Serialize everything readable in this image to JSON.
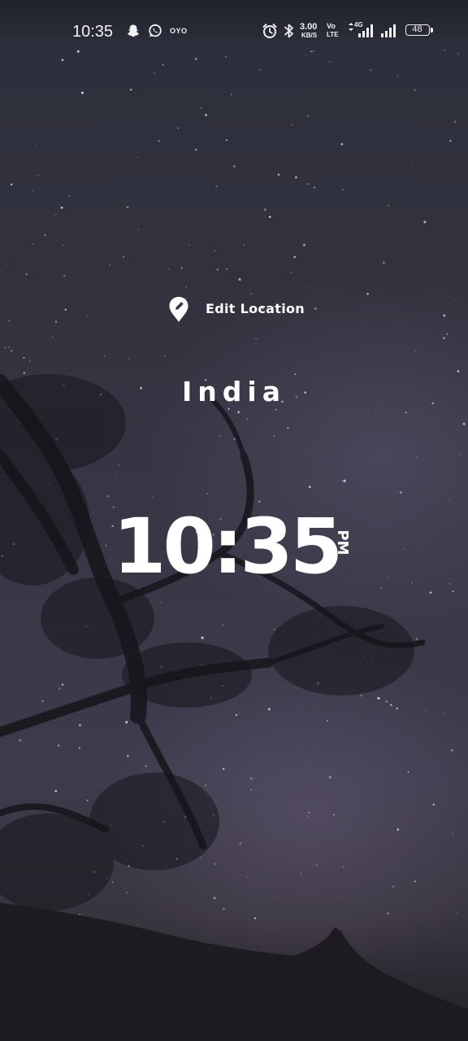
{
  "status_bar": {
    "time": "10:35",
    "notification_icons": [
      "snapchat-icon",
      "whatsapp-icon",
      "oyo-icon"
    ],
    "oyo_label": "OYO",
    "network_speed_value": "3.00",
    "network_speed_unit": "KB/S",
    "volte_top": "Vo",
    "volte_bottom": "LTE",
    "network_type": "4G",
    "system_icons": [
      "alarm-icon",
      "bluetooth-icon",
      "signal-icon",
      "signal-icon"
    ],
    "battery_level": "48"
  },
  "widget": {
    "edit_location_label": "Edit Location",
    "city": "India",
    "time": "10:35",
    "meridiem": "PM"
  },
  "colors": {
    "text": "#ffffff",
    "sky_top": "#2c2e3b",
    "sky_mid": "#3a3747",
    "ground": "#231f26"
  }
}
